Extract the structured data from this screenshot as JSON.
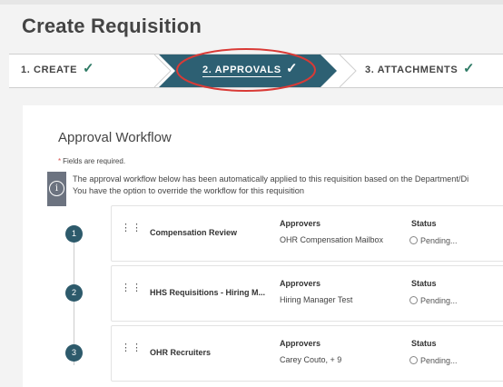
{
  "page": {
    "title": "Create Requisition"
  },
  "steps": [
    {
      "label": "1. CREATE",
      "check": "✓",
      "active": false
    },
    {
      "label": "2. APPROVALS",
      "check": "✓",
      "active": true
    },
    {
      "label": "3. ATTACHMENTS",
      "check": "✓",
      "active": false
    }
  ],
  "workflow": {
    "title": "Approval Workflow",
    "required_star": "*",
    "required_text": "Fields are required.",
    "info_icon": "i",
    "info_line1": "The approval workflow below has been automatically applied to this requisition based on the Department/Di",
    "info_line2": "You have the option to override the workflow for this requisition",
    "approvers_header": "Approvers",
    "status_header": "Status",
    "rows": [
      {
        "number": "1",
        "name": "Compensation Review",
        "approvers": "OHR Compensation Mailbox",
        "status": "Pending..."
      },
      {
        "number": "2",
        "name": "HHS Requisitions - Hiring M...",
        "approvers": "Hiring Manager Test",
        "status": "Pending..."
      },
      {
        "number": "3",
        "name": "OHR Recruiters",
        "approvers": "Carey Couto, + 9",
        "status": "Pending..."
      }
    ]
  },
  "colors": {
    "active_step": "#2d6073",
    "check_green": "#2d7a64",
    "highlight_ring": "#d93a36"
  }
}
